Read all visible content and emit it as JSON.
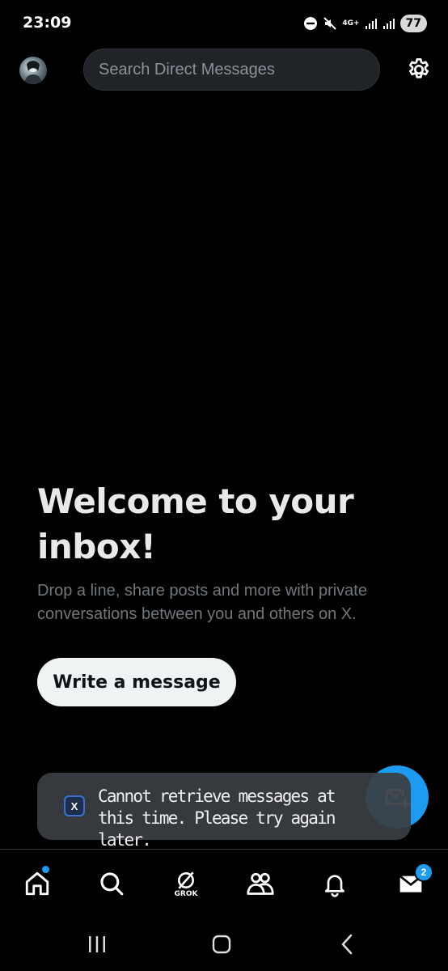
{
  "status_bar": {
    "time": "23:09",
    "network": "4G+",
    "battery": "77"
  },
  "header": {
    "search_placeholder": "Search Direct Messages",
    "icons": [
      "avatar",
      "gear-icon"
    ]
  },
  "welcome": {
    "title": "Welcome to your inbox!",
    "subtitle": "Drop a line, share posts and more with private conversations between you and others on X.",
    "button_label": "Write a message"
  },
  "toast": {
    "app_icon_letter": "X",
    "message": "Cannot retrieve messages at this time. Please try again later."
  },
  "bottom_nav": {
    "grok_label": "GROK",
    "messages_badge": "2",
    "items": [
      "home-icon",
      "search-icon",
      "grok-icon",
      "communities-icon",
      "bell-icon",
      "mail-icon"
    ]
  },
  "colors": {
    "background": "#000000",
    "accent": "#1d9bf0",
    "text_primary": "#e7e9ea",
    "text_secondary": "#71767b",
    "search_bg": "#202327",
    "toast_bg": "#3a3d42"
  }
}
